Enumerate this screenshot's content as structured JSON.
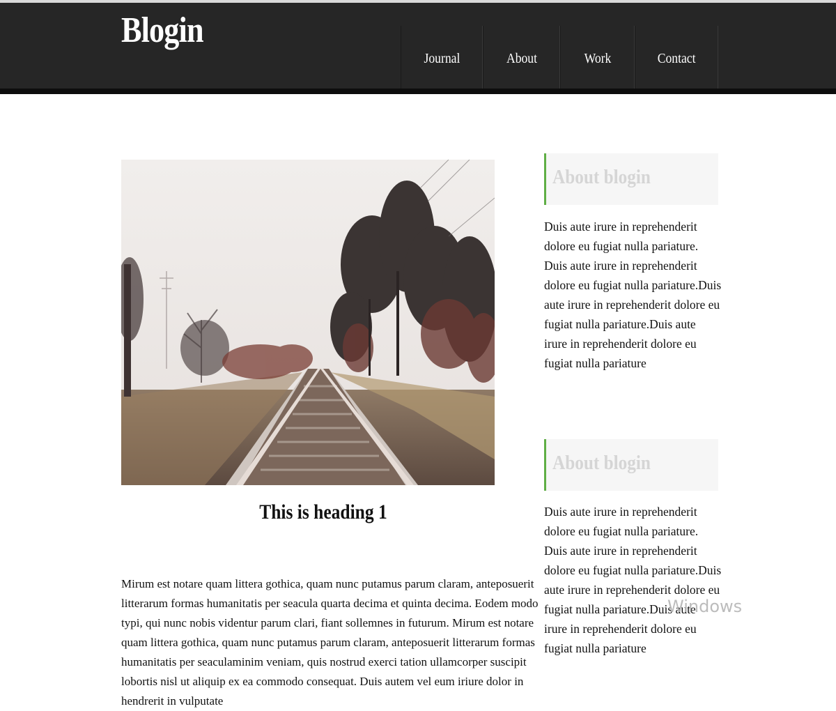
{
  "header": {
    "brand": "Blogin",
    "nav": [
      "Journal",
      "About",
      "Work",
      "Contact"
    ]
  },
  "post": {
    "heading": "This is heading 1",
    "body": "Mirum est notare quam littera gothica, quam nunc putamus parum claram, anteposuerit litterarum formas humanitatis per seacula quarta decima et quinta decima. Eodem modo typi, qui nunc nobis videntur parum clari, fiant sollemnes in futurum. Mirum est notare quam littera gothica, quam nunc putamus parum claram, anteposuerit litterarum formas humanitatis per seaculaminim veniam, quis nostrud exerci tation ullamcorper suscipit lobortis nisl ut aliquip ex ea commodo consequat. Duis autem vel eum iriure dolor in hendrerit in vulputate"
  },
  "sidebar": {
    "widgets": [
      {
        "title": "About blogin",
        "text": "Duis aute irure in reprehenderit dolore eu fugiat nulla pariature. Duis aute irure in reprehenderit dolore eu fugiat nulla pariature.Duis aute irure in reprehenderit dolore eu fugiat nulla pariature.Duis aute irure in reprehenderit dolore eu fugiat nulla pariature"
      },
      {
        "title": "About blogin",
        "text": "Duis aute irure in reprehenderit dolore eu fugiat nulla pariature. Duis aute irure in reprehenderit dolore eu fugiat nulla pariature.Duis aute irure in reprehenderit dolore eu fugiat nulla pariature.Duis aute irure in reprehenderit dolore eu fugiat nulla pariature"
      }
    ]
  },
  "watermark": "Windows",
  "colors": {
    "header_bg": "#262626",
    "accent": "#5fae45",
    "widget_bg": "#f6f6f6",
    "widget_title": "#d5d5d5"
  },
  "icons": {
    "hero": "railway-track-photo"
  }
}
